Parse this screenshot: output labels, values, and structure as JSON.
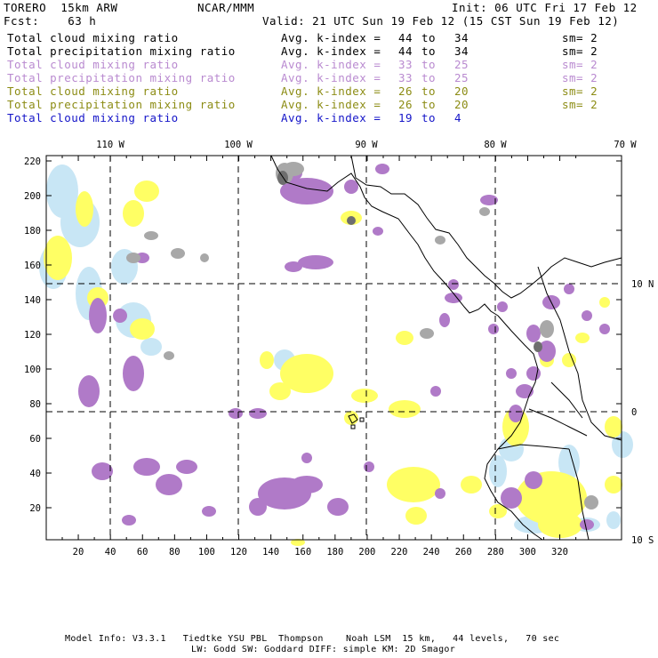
{
  "header": {
    "model": "TORERO  15km ARW",
    "org": "NCAR/MMM",
    "init": "Init: 06 UTC Fri 17 Feb 12",
    "fcst": "Fcst:    63 h",
    "valid": "Valid: 21 UTC Sun 19 Feb 12 (15 CST Sun 19 Feb 12)"
  },
  "legend": [
    {
      "field": "Total cloud mixing ratio",
      "avg": "Avg. k-index = ",
      "from": "44",
      "to": "to",
      "end": "34",
      "sm": "sm= 2",
      "color": "#000000"
    },
    {
      "field": "Total precipitation mixing ratio",
      "avg": "Avg. k-index = ",
      "from": "44",
      "to": "to",
      "end": "34",
      "sm": "sm= 2",
      "color": "#000000"
    },
    {
      "field": "Total cloud mixing ratio",
      "avg": "Avg. k-index = ",
      "from": "33",
      "to": "to",
      "end": "25",
      "sm": "sm= 2",
      "color": "#b98ad0"
    },
    {
      "field": "Total precipitation mixing ratio",
      "avg": "Avg. k-index = ",
      "from": "33",
      "to": "to",
      "end": "25",
      "sm": "sm= 2",
      "color": "#b98ad0"
    },
    {
      "field": "Total cloud mixing ratio",
      "avg": "Avg. k-index = ",
      "from": "26",
      "to": "to",
      "end": "20",
      "sm": "sm= 2",
      "color": "#8c8c14"
    },
    {
      "field": "Total precipitation mixing ratio",
      "avg": "Avg. k-index = ",
      "from": "26",
      "to": "to",
      "end": "20",
      "sm": "sm= 2",
      "color": "#8c8c14"
    },
    {
      "field": "Total cloud mixing ratio",
      "avg": "Avg. k-index = ",
      "from": "19",
      "to": "to",
      "end": "4",
      "sm": "",
      "color": "#1414c8"
    }
  ],
  "axes": {
    "lon_labels": [
      "110 W",
      "100 W",
      "90 W",
      "80 W",
      "70 W"
    ],
    "lat_labels": [
      "10 N",
      "0",
      "10 S"
    ],
    "y_ticks": [
      "220",
      "200",
      "180",
      "160",
      "140",
      "120",
      "100",
      "80",
      "60",
      "40",
      "20"
    ],
    "x_ticks": [
      "20",
      "40",
      "60",
      "80",
      "100",
      "120",
      "140",
      "160",
      "180",
      "200",
      "220",
      "240",
      "260",
      "280",
      "300",
      "320"
    ]
  },
  "footer": {
    "line1": "Model Info: V3.3.1   Tiedtke YSU PBL  Thompson    Noah LSM  15 km,   44 levels,   70 sec",
    "line2": "LW: Godd SW: Goddard DIFF: simple KM: 2D Smagor"
  },
  "colors": {
    "gray": "#a8a8a8",
    "darkgray": "#6e6e6e",
    "purple": "#b07ac8",
    "yellow": "#ffff64",
    "lightblue": "#c8e6f5",
    "coast": "#000000"
  }
}
